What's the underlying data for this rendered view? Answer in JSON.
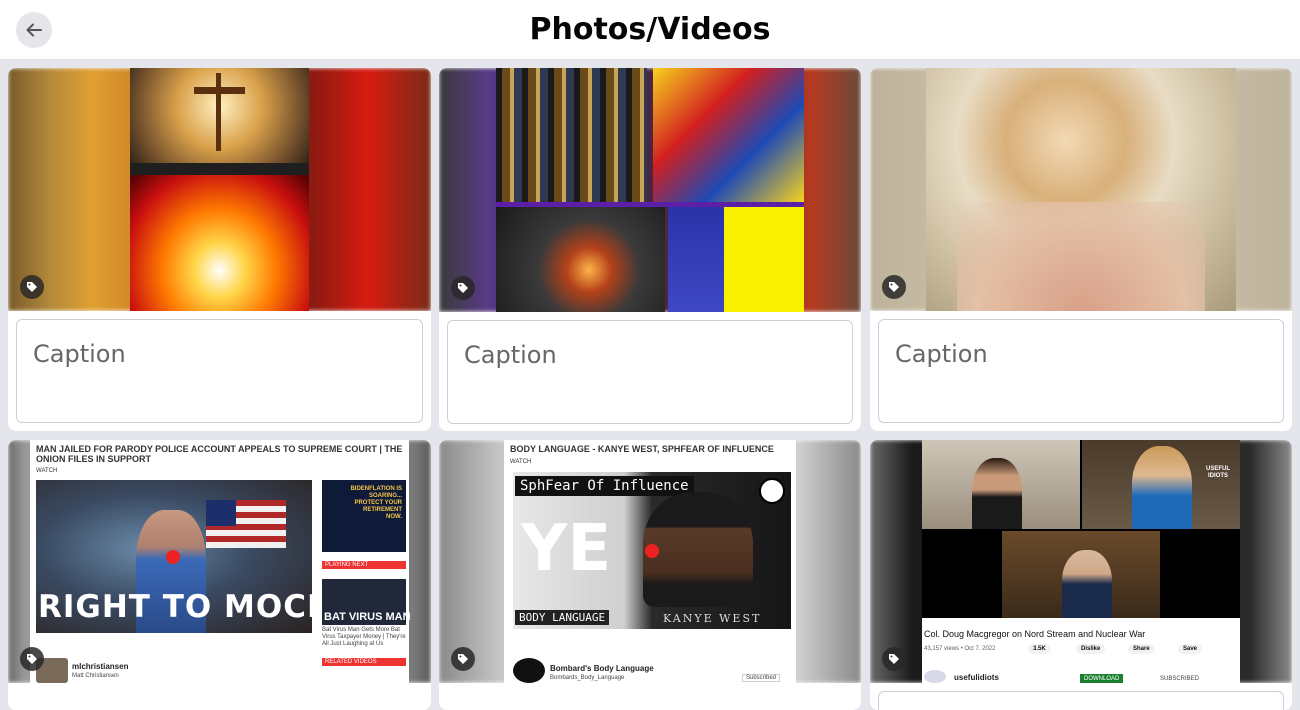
{
  "header": {
    "title": "Photos/Videos",
    "back_icon": "arrow-left-icon"
  },
  "caption_placeholder": "Caption",
  "tag_icon": "tag-icon",
  "videos": [
    {
      "title": "MAN JAILED FOR PARODY POLICE ACCOUNT APPEALS TO SUPREME COURT | THE ONION FILES IN SUPPORT",
      "watch": "WATCH",
      "overlay_text": "RIGHT TO MOCKERY",
      "side_ad": "BIDENFLATION IS SOARING... PROTECT YOUR RETIREMENT NOW.",
      "playing_next": "PLAYING NEXT",
      "side_video": "BAT VIRUS MAN",
      "side_caption": "Bat Virus Man Gets More Bat Virus Taxpayer Money | They're All Just Laughing at Us",
      "related": "RELATED VIDEOS",
      "channel": "mlchristiansen",
      "channel_sub": "Matt Christiansen"
    },
    {
      "title": "BODY LANGUAGE - KANYE WEST, SPHFEAR OF INFLUENCE",
      "watch": "WATCH",
      "overlay_top": "SphFear Of Influence",
      "overlay_text": "YE",
      "overlay_bottom_left": "BODY LANGUAGE",
      "overlay_bottom_right": "KANYE WEST",
      "channel": "Bombard's Body Language",
      "channel_sub": "Bombards_Body_Language",
      "subscribed": "Subscribed"
    },
    {
      "title": "Col. Doug Macgregor on Nord Stream and Nuclear War",
      "views": "43,157 views • Oct 7, 2022",
      "likes": "3.5K",
      "dislike": "Dislike",
      "share": "Share",
      "save": "Save",
      "channel": "usefulidiots",
      "badge": "USEFUL IDIOTS",
      "download": "DOWNLOAD",
      "subscribed": "SUBSCRIBED"
    }
  ]
}
